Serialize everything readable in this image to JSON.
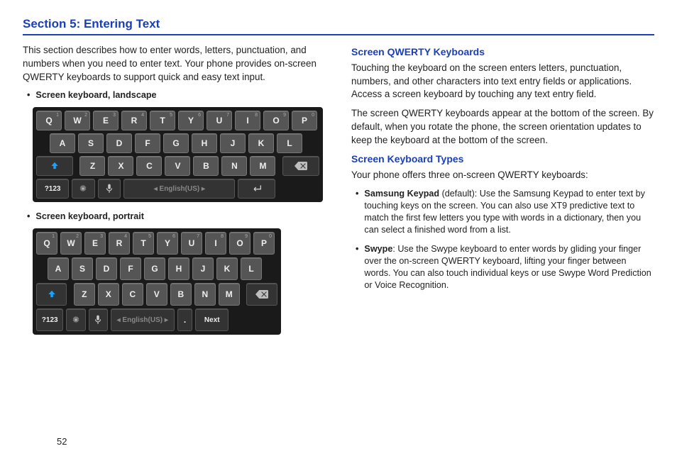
{
  "title": "Section 5: Entering Text",
  "pageNumber": "52",
  "left": {
    "intro": "This section describes how to enter words, letters, punctuation, and numbers when you need to enter text. Your phone provides on-screen QWERTY keyboards to support quick and easy text input.",
    "landscapeLabel": "Screen keyboard, landscape",
    "portraitLabel": "Screen keyboard, portrait"
  },
  "right": {
    "h1": "Screen QWERTY Keyboards",
    "p1": "Touching the keyboard on the screen enters letters, punctuation, numbers, and other characters into text entry fields or applications. Access a screen keyboard by touching any text entry field.",
    "p2": "The screen QWERTY keyboards appear at the bottom of the screen. By default, when you rotate the phone, the screen orientation updates to keep the keyboard at the bottom of the screen.",
    "h2": "Screen Keyboard Types",
    "p3": "Your phone offers three on-screen QWERTY keyboards:",
    "b1Bold": "Samsung Keypad",
    "b1Rest": " (default): Use the Samsung Keypad to enter text by touching keys on the screen. You can also use XT9 predictive text to match the first few letters you type with words in a dictionary, then you can select a finished word from a list.",
    "b2Bold": "Swype",
    "b2Rest": ": Use the Swype keyboard to enter words by gliding your finger over the on-screen QWERTY keyboard, lifting your finger between words. You can also touch individual keys or use Swype Word Prediction or Voice Recognition."
  },
  "kb": {
    "row1": [
      {
        "k": "Q",
        "s": "1"
      },
      {
        "k": "W",
        "s": "2"
      },
      {
        "k": "E",
        "s": "3"
      },
      {
        "k": "R",
        "s": "4"
      },
      {
        "k": "T",
        "s": "5"
      },
      {
        "k": "Y",
        "s": "6"
      },
      {
        "k": "U",
        "s": "7"
      },
      {
        "k": "I",
        "s": "8"
      },
      {
        "k": "O",
        "s": "9"
      },
      {
        "k": "P",
        "s": "0"
      }
    ],
    "row2": [
      "A",
      "S",
      "D",
      "F",
      "G",
      "H",
      "J",
      "K",
      "L"
    ],
    "row3": [
      "Z",
      "X",
      "C",
      "V",
      "B",
      "N",
      "M"
    ],
    "symKey": "?123",
    "lang": "English(US)",
    "enterLabel": "↵",
    "nextLabel": "Next"
  }
}
